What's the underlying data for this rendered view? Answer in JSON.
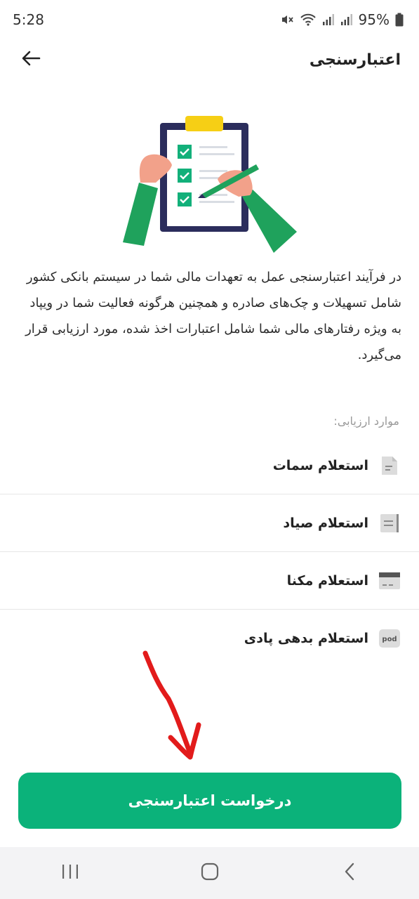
{
  "status_bar": {
    "time": "5:28",
    "battery": "95%",
    "icons": [
      "mute-icon",
      "wifi-icon",
      "signal-icon",
      "signal-icon",
      "battery-icon"
    ]
  },
  "header": {
    "title": "اعتبارسنجی",
    "back_icon": "arrow-left-icon"
  },
  "intro": {
    "description": "در فرآیند اعتبارسنجی عمل به تعهدات مالی شما در سیستم بانکی کشور شامل تسهیلات و چک‌های صادره و همچنین هرگونه فعالیت شما در ویپاد به ویژه رفتارهای مالی شما شامل اعتبارات اخذ شده، مورد ارزیابی قرار می‌گیرد."
  },
  "evaluation": {
    "label": "موارد ارزیابی:",
    "items": [
      {
        "label": "استعلام سمات",
        "icon": "document-icon"
      },
      {
        "label": "استعلام صیاد",
        "icon": "cheque-icon"
      },
      {
        "label": "استعلام مکنا",
        "icon": "card-icon"
      },
      {
        "label": "استعلام بدهی پادی",
        "icon": "pod-icon",
        "icon_text": "pod"
      }
    ]
  },
  "action": {
    "button_label": "درخواست اعتبارسنجی"
  },
  "colors": {
    "accent": "#0bb27a",
    "annotation": "#e21b1b"
  },
  "nav": {
    "icons": [
      "recent-apps-icon",
      "home-icon",
      "back-icon"
    ]
  }
}
